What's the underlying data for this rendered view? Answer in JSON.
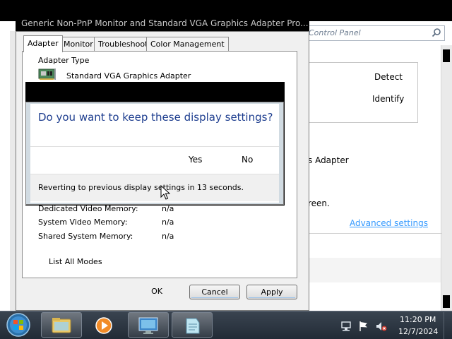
{
  "control_panel": {
    "address_text": "Control Panel",
    "detect_label": "Detect",
    "identify_label": "Identify",
    "adapter_text": "s Adapter",
    "screen_text": "reen.",
    "advanced_link": "Advanced settings"
  },
  "properties_dialog": {
    "title": "Generic Non-PnP Monitor and Standard VGA Graphics Adapter Pro...",
    "tabs": [
      {
        "label": "Adapter",
        "active": true
      },
      {
        "label": "Monitor",
        "active": false
      },
      {
        "label": "Troubleshoot",
        "active": false
      },
      {
        "label": "Color Management",
        "active": false
      }
    ],
    "adapter_type_label": "Adapter Type",
    "adapter_name": "Standard VGA Graphics Adapter",
    "memory": [
      {
        "label": "Dedicated Video Memory:",
        "value": "n/a"
      },
      {
        "label": "System Video Memory:",
        "value": "n/a"
      },
      {
        "label": "Shared System Memory:",
        "value": "n/a"
      }
    ],
    "list_all_modes": "List All Modes",
    "ok": "OK",
    "cancel": "Cancel",
    "apply": "Apply"
  },
  "confirm_dialog": {
    "question": "Do you want to keep these display settings?",
    "yes": "Yes",
    "no": "No",
    "revert_message": "Reverting to previous display settings in 13 seconds."
  },
  "taskbar": {
    "time": "11:20 PM",
    "date": "12/7/2024",
    "pinned": [
      "explorer-icon",
      "media-player-icon",
      "display-settings-icon",
      "notepad-icon"
    ]
  }
}
